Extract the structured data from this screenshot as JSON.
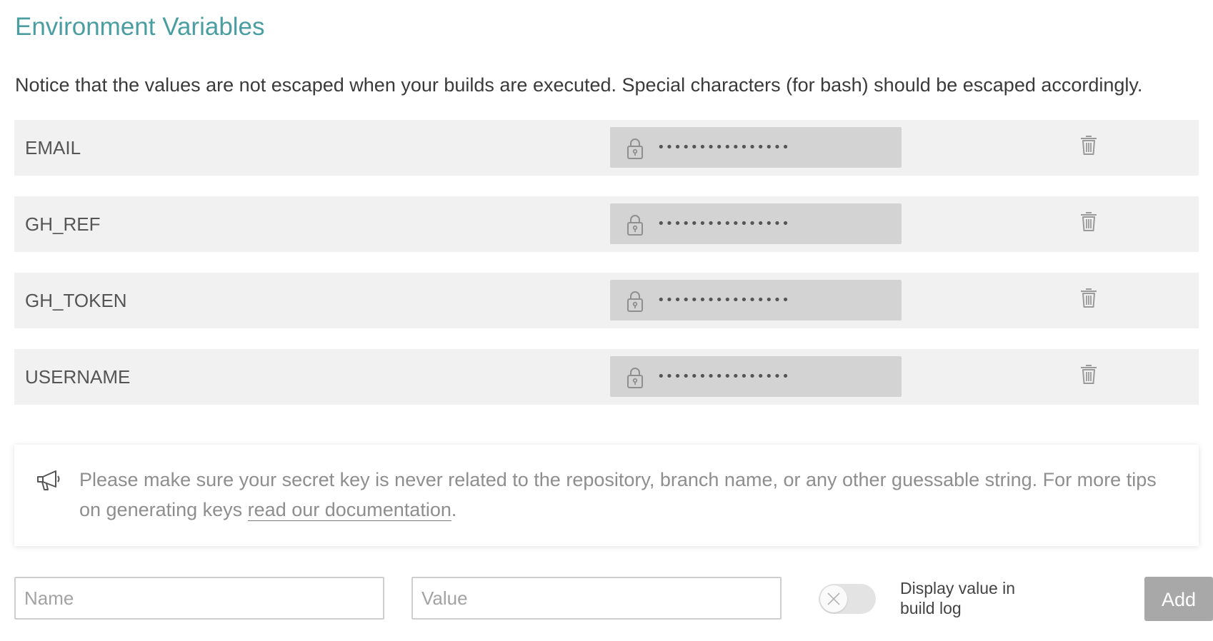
{
  "section": {
    "title": "Environment Variables",
    "notice": "Notice that the values are not escaped when your builds are executed. Special characters (for bash) should be escaped accordingly."
  },
  "env_vars": [
    {
      "name": "EMAIL",
      "value": "••••••••••••••••"
    },
    {
      "name": "GH_REF",
      "value": "••••••••••••••••"
    },
    {
      "name": "GH_TOKEN",
      "value": "••••••••••••••••"
    },
    {
      "name": "USERNAME",
      "value": "••••••••••••••••"
    }
  ],
  "tip": {
    "text": "Please make sure your secret key is never related to the repository, branch name, or any other guessable string. For more tips on generating keys ",
    "link_text": "read our documentation",
    "suffix": "."
  },
  "form": {
    "name_placeholder": "Name",
    "value_placeholder": "Value",
    "toggle_label": "Display value in build log",
    "toggle_on": false,
    "add_label": "Add"
  },
  "colors": {
    "title": "#4a9ea1",
    "row_bg": "#f1f1f1",
    "masked_value_bg": "#d3d3d3",
    "add_button": "#a8a8a8"
  },
  "icons": {
    "lock": "lock-icon",
    "trash": "trash-icon",
    "megaphone": "megaphone-icon",
    "toggle_off": "close-icon"
  }
}
